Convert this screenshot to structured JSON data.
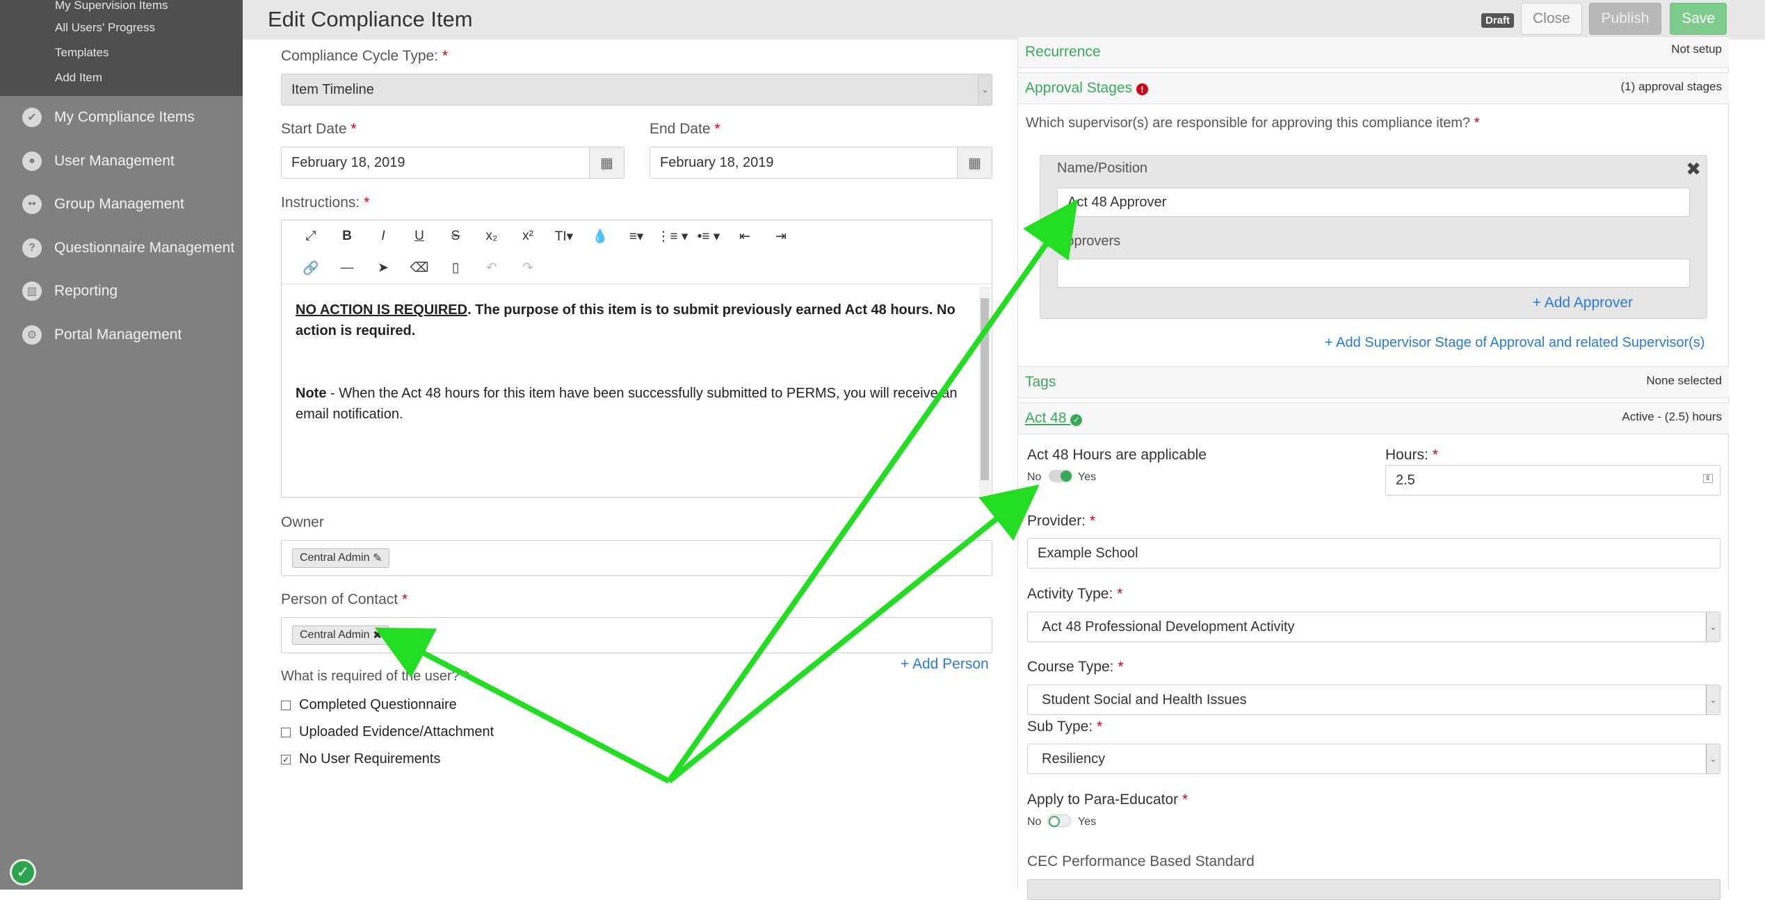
{
  "sidebar": {
    "sub_items": [
      "My Supervision Items",
      "All Users' Progress",
      "Templates",
      "Add Item"
    ],
    "items": [
      {
        "label": "My Compliance Items",
        "icon": "check-circle-icon"
      },
      {
        "label": "User Management",
        "icon": "user-icon"
      },
      {
        "label": "Group Management",
        "icon": "group-icon"
      },
      {
        "label": "Questionnaire Management",
        "icon": "question-icon"
      },
      {
        "label": "Reporting",
        "icon": "chart-icon"
      },
      {
        "label": "Portal Management",
        "icon": "gear-icon"
      }
    ]
  },
  "header": {
    "title": "Edit Compliance Item",
    "badge": "Draft",
    "close": "Close",
    "publish": "Publish",
    "save": "Save"
  },
  "form": {
    "cycle_type_label": "Compliance Cycle Type:",
    "cycle_type_value": "Item Timeline",
    "start_label": "Start Date",
    "start_value": "February 18, 2019",
    "end_label": "End Date",
    "end_value": "February 18, 2019",
    "instructions_label": "Instructions:",
    "instructions_p1_bold_underline": "NO ACTION IS REQUIRED",
    "instructions_p1_rest": ".  The purpose of this item is to submit previously earned Act 48 hours. No action is required.",
    "instructions_p2_bold": "Note",
    "instructions_p2_rest": " - When the Act 48 hours for this item have been successfully submitted to PERMS, you will receive an email notification.",
    "owner_label": "Owner",
    "owner_tag": "Central Admin",
    "contact_label": "Person of Contact",
    "contact_tag": "Central Admin",
    "add_person": "+ Add Person",
    "required_label": "What is required of the user?",
    "requirements": [
      {
        "label": "Completed Questionnaire",
        "checked": false
      },
      {
        "label": "Uploaded Evidence/Attachment",
        "checked": false
      },
      {
        "label": "No User Requirements",
        "checked": true
      }
    ]
  },
  "right": {
    "recurrence_title": "Recurrence",
    "recurrence_status": "Not setup",
    "approval_title": "Approval Stages",
    "approval_status": "(1) approval stages",
    "approval_question": "Which supervisor(s) are responsible for approving this compliance item?",
    "name_position_label": "Name/Position",
    "name_position_value": "Act 48 Approver",
    "approvers_label": "Approvers",
    "add_approver": "+ Add Approver",
    "add_stage": "+ Add Supervisor Stage of Approval and related Supervisor(s)",
    "tags_title": "Tags",
    "tags_status": "None selected",
    "act48_title": "Act 48",
    "act48_status": "Active - (2.5) hours",
    "hours_applicable_label": "Act 48 Hours are applicable",
    "toggle_no": "No",
    "toggle_yes": "Yes",
    "hours_label": "Hours:",
    "hours_value": "2.5",
    "provider_label": "Provider:",
    "provider_value": "Example School",
    "activity_label": "Activity Type:",
    "activity_value": "Act 48 Professional Development Activity",
    "course_label": "Course Type:",
    "course_value": "Student Social and Health Issues",
    "subtype_label": "Sub Type:",
    "subtype_value": "Resiliency",
    "para_label": "Apply to Para-Educator",
    "cec_label": "CEC Performance Based Standard"
  },
  "colors": {
    "accent_green": "#3aa85a",
    "annotation_arrow": "#22dd22",
    "required_red": "#d0021b",
    "link_blue": "#2a7ad5"
  }
}
